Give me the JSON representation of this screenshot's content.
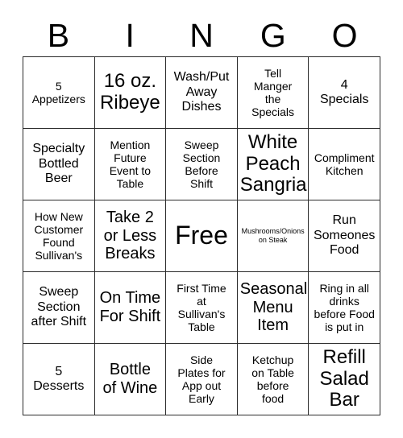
{
  "header": {
    "letters": [
      "B",
      "I",
      "N",
      "G",
      "O"
    ]
  },
  "grid": {
    "columns": 5,
    "rows": 5,
    "cells": [
      {
        "text": "5\nAppetizers",
        "size": "s"
      },
      {
        "text": "16 oz.\nRibeye",
        "size": "xl"
      },
      {
        "text": "Wash/Put\nAway\nDishes",
        "size": "m"
      },
      {
        "text": "Tell\nManger\nthe\nSpecials",
        "size": "s"
      },
      {
        "text": "4\nSpecials",
        "size": "m"
      },
      {
        "text": "Specialty\nBottled\nBeer",
        "size": "m"
      },
      {
        "text": "Mention\nFuture\nEvent to\nTable",
        "size": "s"
      },
      {
        "text": "Sweep\nSection\nBefore\nShift",
        "size": "s"
      },
      {
        "text": "White\nPeach\nSangria",
        "size": "xl"
      },
      {
        "text": "Compliment\nKitchen",
        "size": "s"
      },
      {
        "text": "How New\nCustomer\nFound\nSullivan's",
        "size": "s"
      },
      {
        "text": "Take 2\nor Less\nBreaks",
        "size": "l"
      },
      {
        "text": "Free",
        "size": "xxl"
      },
      {
        "text": "Mushrooms/Onions\non Steak",
        "size": "xs"
      },
      {
        "text": "Run\nSomeones\nFood",
        "size": "m"
      },
      {
        "text": "Sweep\nSection\nafter Shift",
        "size": "m"
      },
      {
        "text": "On Time\nFor Shift",
        "size": "l"
      },
      {
        "text": "First Time\nat\nSullivan's\nTable",
        "size": "s"
      },
      {
        "text": "Seasonal\nMenu\nItem",
        "size": "l"
      },
      {
        "text": "Ring in all\ndrinks\nbefore Food\nis put in",
        "size": "s"
      },
      {
        "text": "5\nDesserts",
        "size": "m"
      },
      {
        "text": "Bottle\nof Wine",
        "size": "l"
      },
      {
        "text": "Side\nPlates for\nApp out\nEarly",
        "size": "s"
      },
      {
        "text": "Ketchup\non Table\nbefore\nfood",
        "size": "s"
      },
      {
        "text": "Refill\nSalad\nBar",
        "size": "xl"
      }
    ]
  },
  "colors": {
    "background": "#ffffff",
    "text": "#000000",
    "border": "#2b2b2b"
  }
}
